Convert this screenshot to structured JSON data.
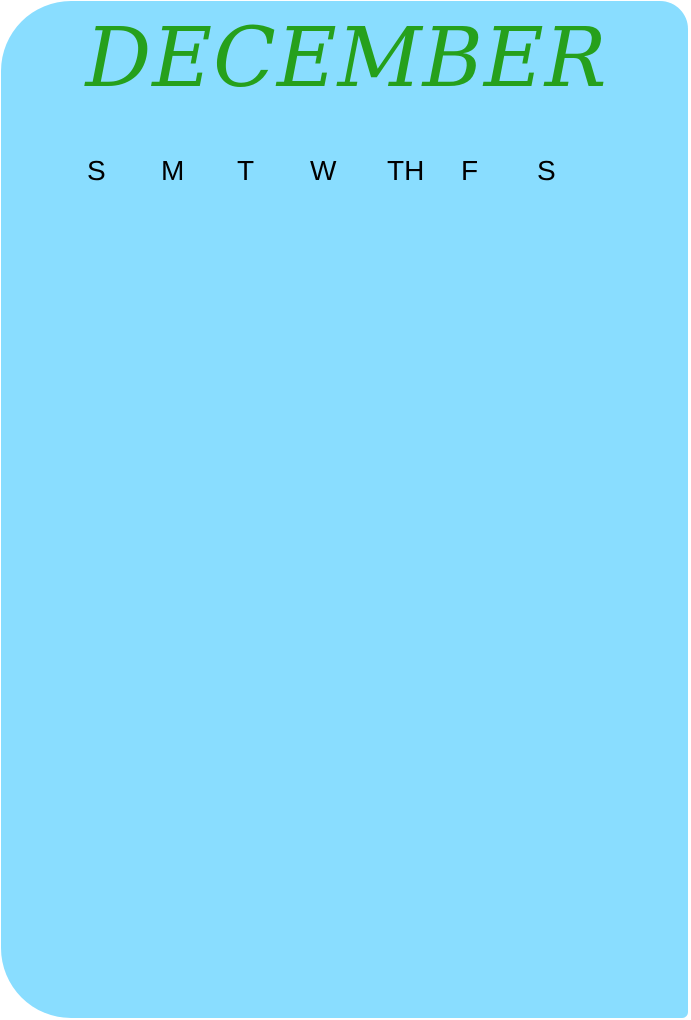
{
  "calendar": {
    "month": "DECEMBER",
    "weekdays": [
      "S",
      "M",
      "T",
      "W",
      "TH",
      "F",
      "S"
    ]
  },
  "colors": {
    "background": "#89ddff",
    "title": "#26a01c",
    "weekday_text": "#000000"
  }
}
